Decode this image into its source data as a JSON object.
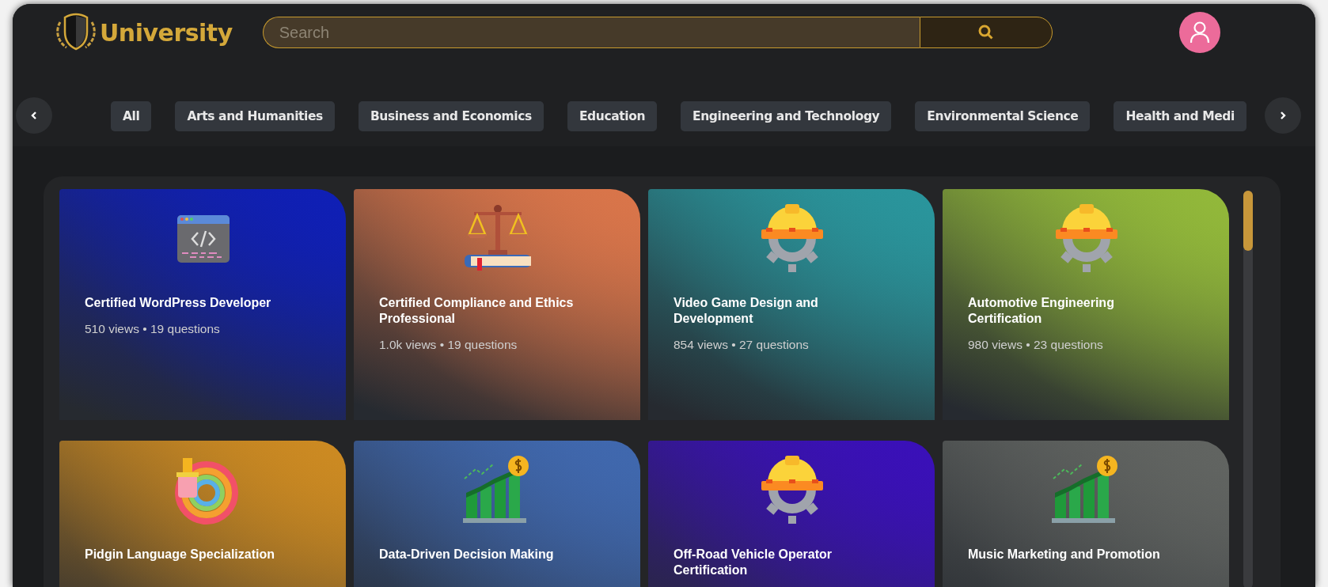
{
  "header": {
    "logo_text": "University",
    "search": {
      "placeholder": "Search"
    }
  },
  "categories": [
    {
      "label": "All"
    },
    {
      "label": "Arts and Humanities"
    },
    {
      "label": "Business and Economics"
    },
    {
      "label": "Education"
    },
    {
      "label": "Engineering and Technology"
    },
    {
      "label": "Environmental Science"
    },
    {
      "label": "Health and Medi"
    }
  ],
  "courses": [
    {
      "title": "Certified WordPress Developer",
      "stats": "510 views • 19 questions",
      "kind": "code",
      "color": "#0f1fb5"
    },
    {
      "title": "Certified Compliance and Ethics Professional",
      "stats": "1.0k views • 19 questions",
      "kind": "scales",
      "color": "#d9754a"
    },
    {
      "title": "Video Game Design and Development",
      "stats": "854 views • 27 questions",
      "kind": "helmet",
      "color": "#2a959c"
    },
    {
      "title": "Automotive Engineering Certification",
      "stats": "980 views • 23 questions",
      "kind": "helmet",
      "color": "#92b83a"
    },
    {
      "title": "Pidgin Language Specialization",
      "kind": "palette",
      "color": "#cc8a22"
    },
    {
      "title": "Data-Driven Decision Making",
      "kind": "chart",
      "color": "#4068ae"
    },
    {
      "title": "Off-Road Vehicle Operator Certification",
      "kind": "helmet",
      "color": "#3a10b8"
    },
    {
      "title": "Music Marketing and Promotion",
      "kind": "chart",
      "color": "#616461"
    }
  ]
}
